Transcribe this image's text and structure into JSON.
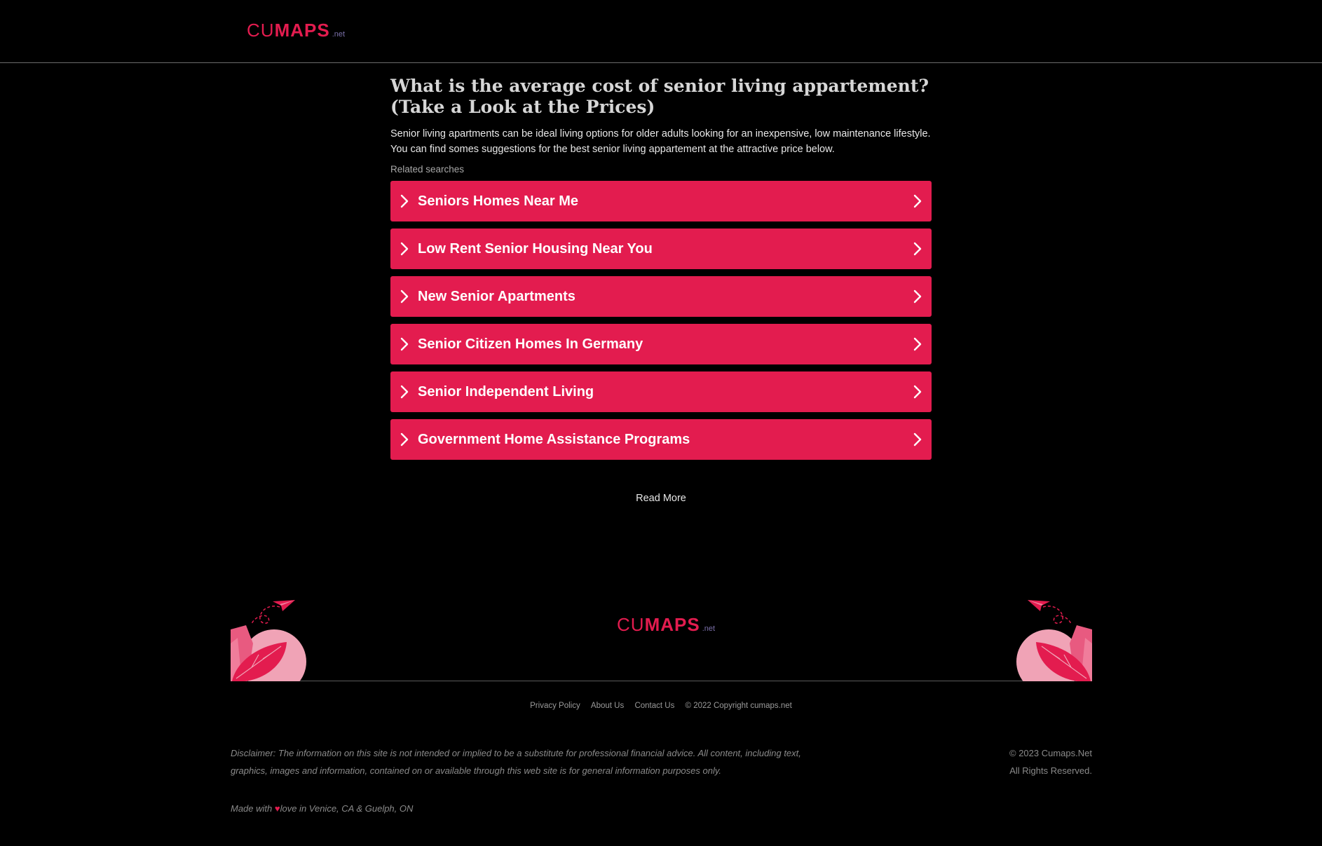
{
  "header": {
    "logo": {
      "cu": "CU",
      "maps": "MAPS",
      "net": ".net"
    }
  },
  "main": {
    "title": "What is the average cost of senior living appartement? (Take a Look at the Prices)",
    "intro": "Senior living apartments can be ideal living options for older adults looking for an inexpensive, low maintenance lifestyle. You can find somes suggestions for the best senior living appartement at the attractive price below.",
    "related_label": "Related searches",
    "items": [
      {
        "label": "Seniors Homes Near Me"
      },
      {
        "label": "Low Rent Senior Housing Near You"
      },
      {
        "label": "New Senior Apartments"
      },
      {
        "label": "Senior Citizen Homes In Germany"
      },
      {
        "label": "Senior Independent Living"
      },
      {
        "label": "Government Home Assistance Programs"
      }
    ],
    "read_more": "Read More"
  },
  "footer": {
    "logo": {
      "cu": "CU",
      "maps": "MAPS",
      "net": ".net"
    },
    "links": {
      "privacy": "Privacy Policy",
      "about": "About Us",
      "contact": "Contact Us",
      "copyright": "© 2022 Copyright cumaps.net"
    },
    "disclaimer": "Disclaimer: The information on this site is not intended or implied to be a substitute for professional financial advice. All content, including text, graphics, images and information, contained on or available through this web site is for general information purposes only.",
    "rights_line1": "© 2023 Cumaps.Net",
    "rights_line2": "All Rights Reserved.",
    "made_prefix": "Made with ",
    "made_heart": "♥",
    "made_suffix": "love in Venice, CA & Guelph, ON"
  },
  "colors": {
    "accent": "#e31c4f",
    "background": "#000000",
    "net_purple": "#7a6fa8"
  }
}
